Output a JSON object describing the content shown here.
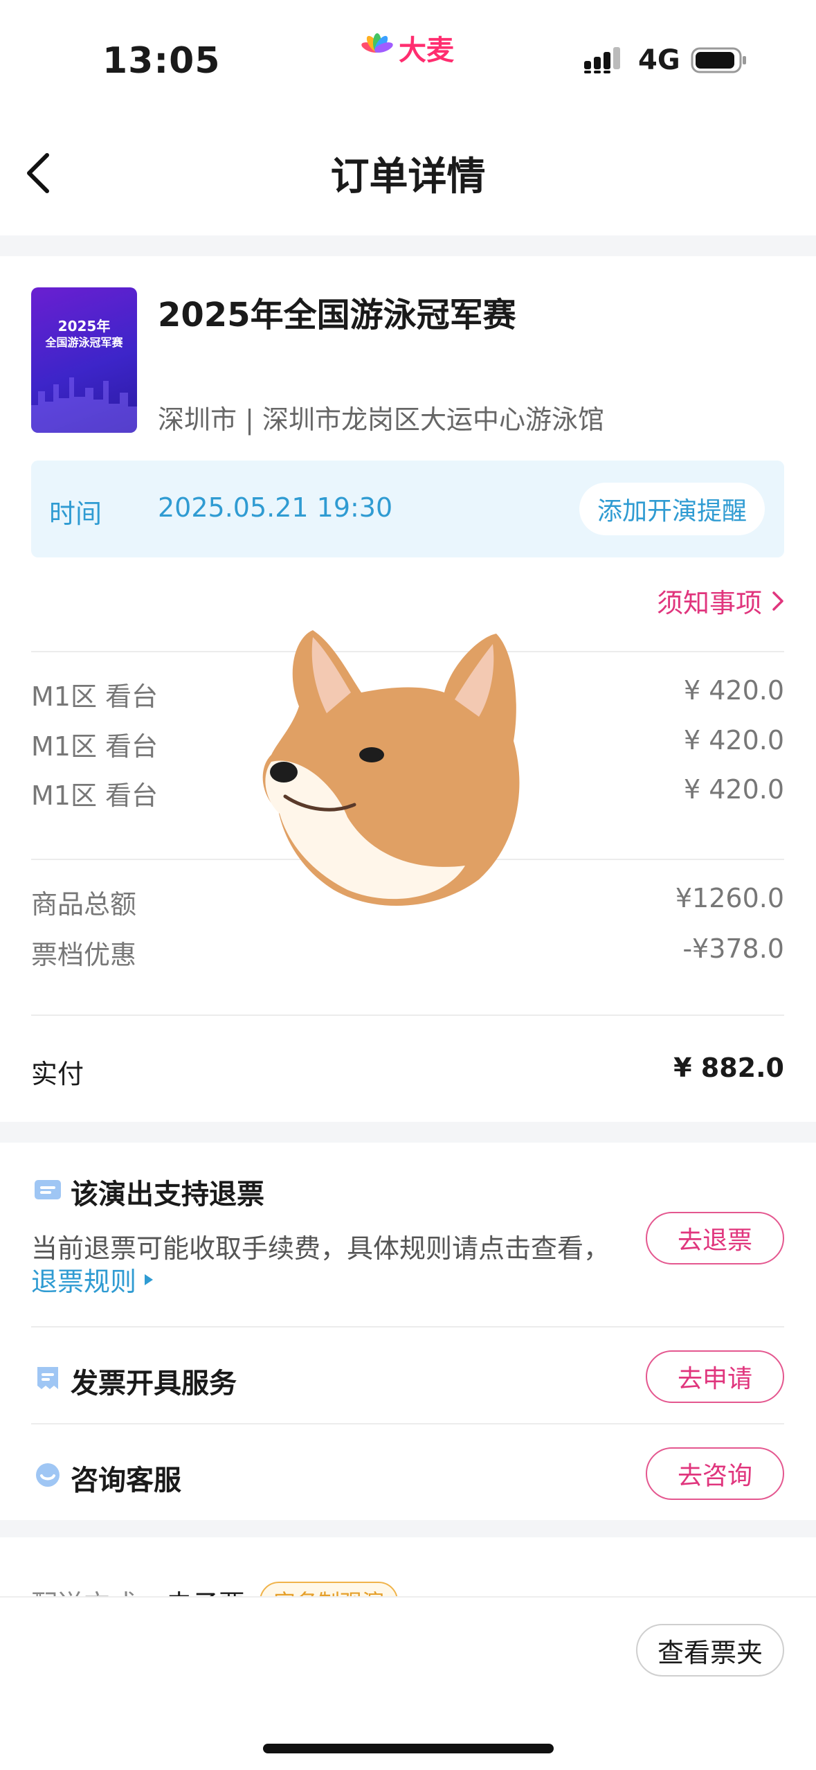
{
  "status_bar": {
    "time": "13:05",
    "app_logo": "大麦",
    "network": "4G",
    "icons": [
      "signal-icon",
      "battery-icon"
    ]
  },
  "nav": {
    "title": "订单详情",
    "back_icon": "back-chevron-icon"
  },
  "event": {
    "poster_year": "2025年",
    "poster_title": "全国游泳冠军赛",
    "title": "2025年全国游泳冠军赛",
    "venue": "深圳市 | 深圳市龙岗区大运中心游泳馆",
    "time_label": "时间",
    "time_value": "2025.05.21 19:30",
    "reminder_button": "添加开演提醒"
  },
  "notice_link": "须知事项",
  "tickets": [
    {
      "name": "M1区 看台",
      "price": "¥ 420.0"
    },
    {
      "name": "M1区 看台",
      "price": "¥ 420.0"
    },
    {
      "name": "M1区 看台",
      "price": "¥ 420.0"
    }
  ],
  "summary": {
    "subtotal_label": "商品总额",
    "subtotal": "¥1260.0",
    "discount_label": "票档优惠",
    "discount": "-¥378.0",
    "paid_label": "实付",
    "paid": "¥ 882.0"
  },
  "services": {
    "refund": {
      "title": "该演出支持退票",
      "desc": "当前退票可能收取手续费，具体规则请点击查看，",
      "link": "退票规则",
      "button": "去退票"
    },
    "invoice": {
      "title": "发票开具服务",
      "button": "去申请"
    },
    "support": {
      "title": "咨询客服",
      "button": "去咨询"
    }
  },
  "delivery": {
    "label": "配送方式",
    "value": "电子票",
    "badge": "实名制观演"
  },
  "bottom": {
    "ticket_wallet_button": "查看票夹"
  },
  "colors": {
    "accent": "#e0357d",
    "info": "#2f9bd2",
    "brand": "#ff2d6f"
  }
}
